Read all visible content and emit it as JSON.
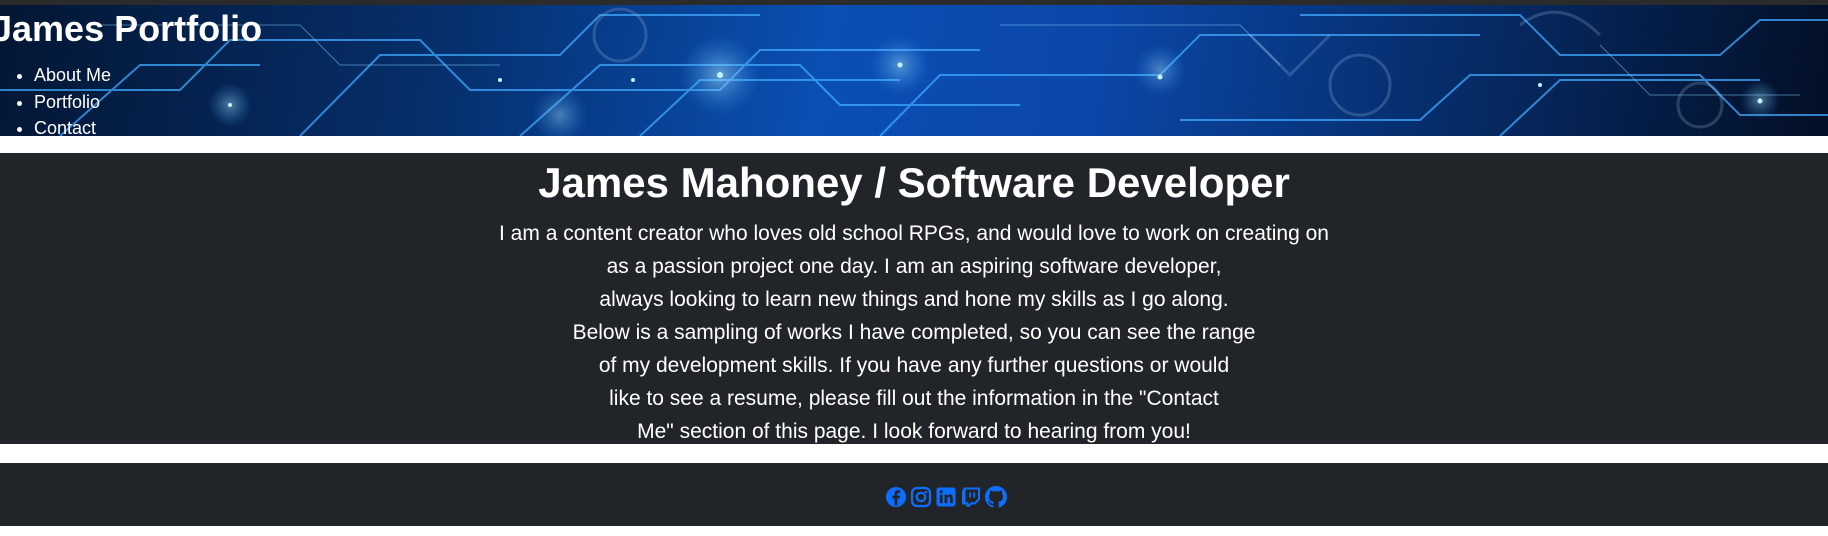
{
  "header": {
    "title": "James Portfolio",
    "nav": [
      {
        "label": "About Me"
      },
      {
        "label": "Portfolio"
      },
      {
        "label": "Contact"
      }
    ]
  },
  "about": {
    "heading": "James Mahoney / Software Developer",
    "bio_lines": [
      "I am a content creator who loves old school RPGs, and would love to work on creating on",
      "as a passion project one day. I am an aspiring software developer,",
      "always looking to learn new things and hone my skills as I go along.",
      "Below is a sampling of works I have completed, so you can see the range",
      "of my development skills. If you have any further questions or would",
      "like to see a resume, please fill out the information in the \"Contact",
      "Me\" section of this page. I look forward to hearing from you!"
    ]
  },
  "footer": {
    "social_icons": [
      "facebook-icon",
      "instagram-icon",
      "linkedin-icon",
      "twitch-icon",
      "github-icon"
    ]
  },
  "colors": {
    "section_bg": "#212529",
    "text": "#ffffff",
    "icon_accent": "#0d6efd",
    "banner_blue": "#0a4fb3"
  }
}
